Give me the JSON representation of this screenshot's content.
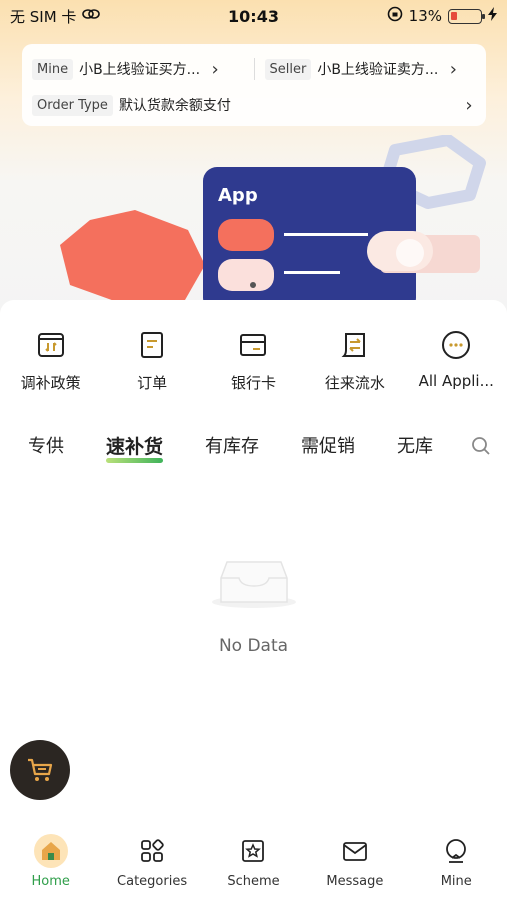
{
  "status_bar": {
    "carrier": "无 SIM 卡",
    "time": "10:43",
    "battery_percent": "13%",
    "battery_level": 0.13
  },
  "info_card": {
    "mine_tag": "Mine",
    "mine_value": "小B上线验证买方...",
    "seller_tag": "Seller",
    "seller_value": "小B上线验证卖方...",
    "order_type_tag": "Order Type",
    "order_type_value": "默认货款余额支付"
  },
  "banner": {
    "card_title": "App"
  },
  "quick_apps": [
    {
      "label": "调补政策",
      "icon": "policy-icon"
    },
    {
      "label": "订单",
      "icon": "order-icon"
    },
    {
      "label": "银行卡",
      "icon": "bank-card-icon"
    },
    {
      "label": "往来流水",
      "icon": "transaction-icon"
    },
    {
      "label": "All Appli...",
      "icon": "more-icon"
    }
  ],
  "tabs": [
    {
      "label": "专供",
      "active": false
    },
    {
      "label": "速补货",
      "active": true
    },
    {
      "label": "有库存",
      "active": false
    },
    {
      "label": "需促销",
      "active": false
    },
    {
      "label": "无库",
      "active": false
    }
  ],
  "empty_state": {
    "label": "No Data"
  },
  "bottom_nav": [
    {
      "label": "Home",
      "icon": "home-icon",
      "active": true
    },
    {
      "label": "Categories",
      "icon": "categories-icon",
      "active": false
    },
    {
      "label": "Scheme",
      "icon": "scheme-icon",
      "active": false
    },
    {
      "label": "Message",
      "icon": "message-icon",
      "active": false
    },
    {
      "label": "Mine",
      "icon": "mine-icon",
      "active": false
    }
  ],
  "colors": {
    "accent_green": "#2f9e4a",
    "icon_gold": "#c8992e",
    "banner_navy": "#2f3a8f",
    "banner_coral": "#f4705d"
  }
}
